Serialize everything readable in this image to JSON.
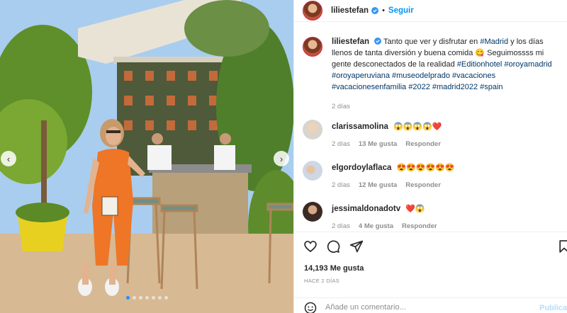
{
  "post": {
    "username": "liliestefan",
    "follow_label": "Seguir",
    "separator": "•",
    "caption_text": "Tanto que ver y disfrutar en",
    "caption_tag_madrid": "#Madrid",
    "caption_mid": "y los días llenos de tanta diversión y buena comida 😋 Seguimossss mi gente desconectados de la realidad",
    "caption_tags_line": "#Editionhotel #oroyamadrid #oroyaperuviana #museodelprado #vacaciones #vacacionesenfamilia #2022 #madrid2022 #spain",
    "caption_time": "2 días",
    "likes": "14,193 Me gusta",
    "posted_ago": "HACE 2 DÍAS"
  },
  "comments": [
    {
      "username": "clarissamolina",
      "text": "😱😱😱😱❤️",
      "time": "2 días",
      "likes": "13 Me gusta",
      "reply": "Responder"
    },
    {
      "username": "elgordoylaflaca",
      "text": "😍😍😍😍😍😍",
      "time": "2 días",
      "likes": "12 Me gusta",
      "reply": "Responder"
    },
    {
      "username": "jessimaldonadotv",
      "text": "❤️😱",
      "time": "2 días",
      "likes": "4 Me gusta",
      "reply": "Responder"
    }
  ],
  "compose": {
    "placeholder": "Añade un comentario...",
    "publish_label": "Publicar"
  },
  "icons": {
    "verified": "verified-badge-icon",
    "like": "heart-icon",
    "comment": "comment-bubble-icon",
    "share": "paper-plane-icon",
    "save": "bookmark-icon",
    "emoji": "smiley-icon"
  },
  "colors": {
    "accent": "#0095f6",
    "verified": "#3897f0",
    "text": "#262626",
    "muted": "#8e8e8e",
    "tag": "#00376b"
  }
}
